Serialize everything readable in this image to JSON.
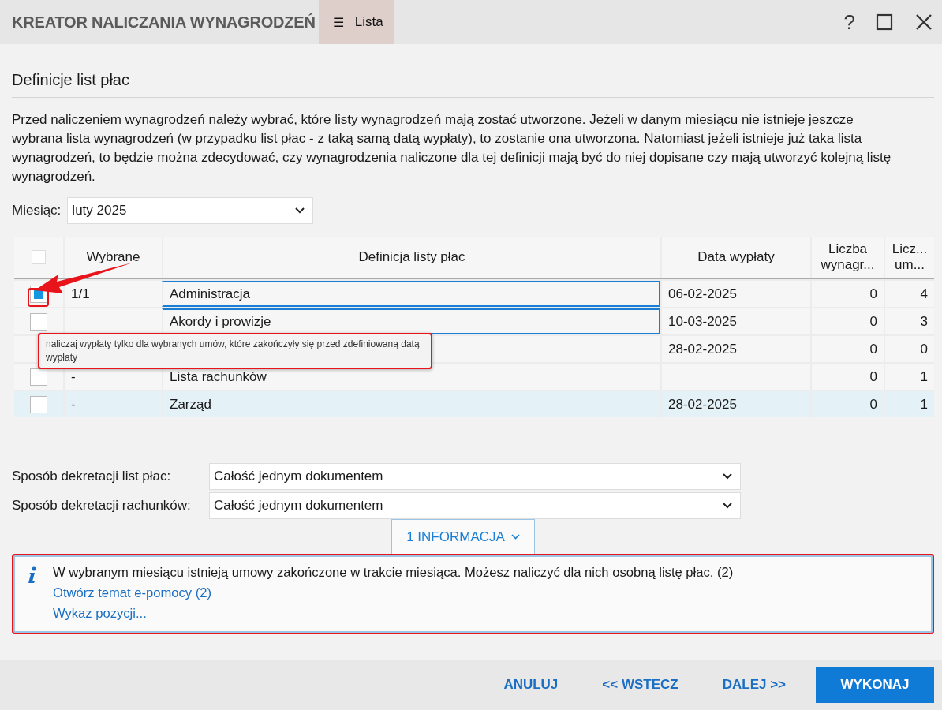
{
  "window": {
    "title": "KREATOR NALICZANIA WYNAGRODZEŃ",
    "menu_icon": "☰",
    "menu_label": "Lista",
    "help": "?"
  },
  "section_title": "Definicje list płac",
  "description": "Przed naliczeniem wynagrodzeń należy wybrać, które listy wynagrodzeń mają zostać utworzone. Jeżeli w danym miesiącu nie istnieje jeszcze wybrana lista wynagrodzeń (w przypadku list płac - z taką samą datą wypłaty), to zostanie ona utworzona. Natomiast jeżeli istnieje już taka lista wynagrodzeń, to będzie można zdecydować, czy wynagrodzenia naliczone dla tej definicji mają być do niej dopisane czy mają utworzyć kolejną listę wynagrodzeń.",
  "month": {
    "label": "Miesiąc:",
    "value": "luty 2025"
  },
  "table": {
    "all_checked": false,
    "columns": [
      "Wybrane",
      "Definicja listy płac",
      "Data wypłaty",
      "Liczba wynagr...",
      "Licz... um..."
    ],
    "rows": [
      {
        "checked": true,
        "selected": false,
        "focused": true,
        "chosen": "1/1",
        "name": "Administracja",
        "date": "06-02-2025",
        "count": "0",
        "contracts": "4"
      },
      {
        "checked": false,
        "selected": false,
        "focused": true,
        "chosen": "",
        "name": "Akordy i prowizje",
        "date": "10-03-2025",
        "count": "0",
        "contracts": "3"
      },
      {
        "selected": false,
        "focused": false,
        "chosen": "",
        "name": "",
        "date": "28-02-2025",
        "count": "0",
        "contracts": "0"
      },
      {
        "checked": false,
        "selected": false,
        "focused": false,
        "chosen": "-",
        "name": "Lista rachunków",
        "date": "",
        "count": "0",
        "contracts": "1"
      },
      {
        "checked": false,
        "selected": true,
        "focused": false,
        "chosen": "-",
        "name": "Zarząd",
        "date": "28-02-2025",
        "count": "0",
        "contracts": "1"
      }
    ]
  },
  "tooltip": "naliczaj wypłaty tylko dla wybranych umów, które zakończyły się przed zdefiniowaną datą wypłaty",
  "selects": [
    {
      "label": "Sposób dekretacji list płac:",
      "value": "Całość jednym dokumentem"
    },
    {
      "label": "Sposób dekretacji rachunków:",
      "value": "Całość jednym dokumentem"
    }
  ],
  "info_toggle": {
    "label": "1 INFORMACJA",
    "expanded": true
  },
  "info": {
    "message": "W wybranym miesiącu istnieją umowy zakończone w trakcie miesiąca. Możesz naliczyć dla nich osobną listę płac. (2)",
    "links": [
      "Otwórz temat e-pomocy (2)",
      "Wykaz pozycji..."
    ]
  },
  "buttons": [
    {
      "label": "ANULUJ",
      "kind": "text"
    },
    {
      "label": "<< WSTECZ",
      "kind": "text"
    },
    {
      "label": "DALEJ >>",
      "kind": "text"
    },
    {
      "label": "WYKONAJ",
      "kind": "primary"
    }
  ]
}
